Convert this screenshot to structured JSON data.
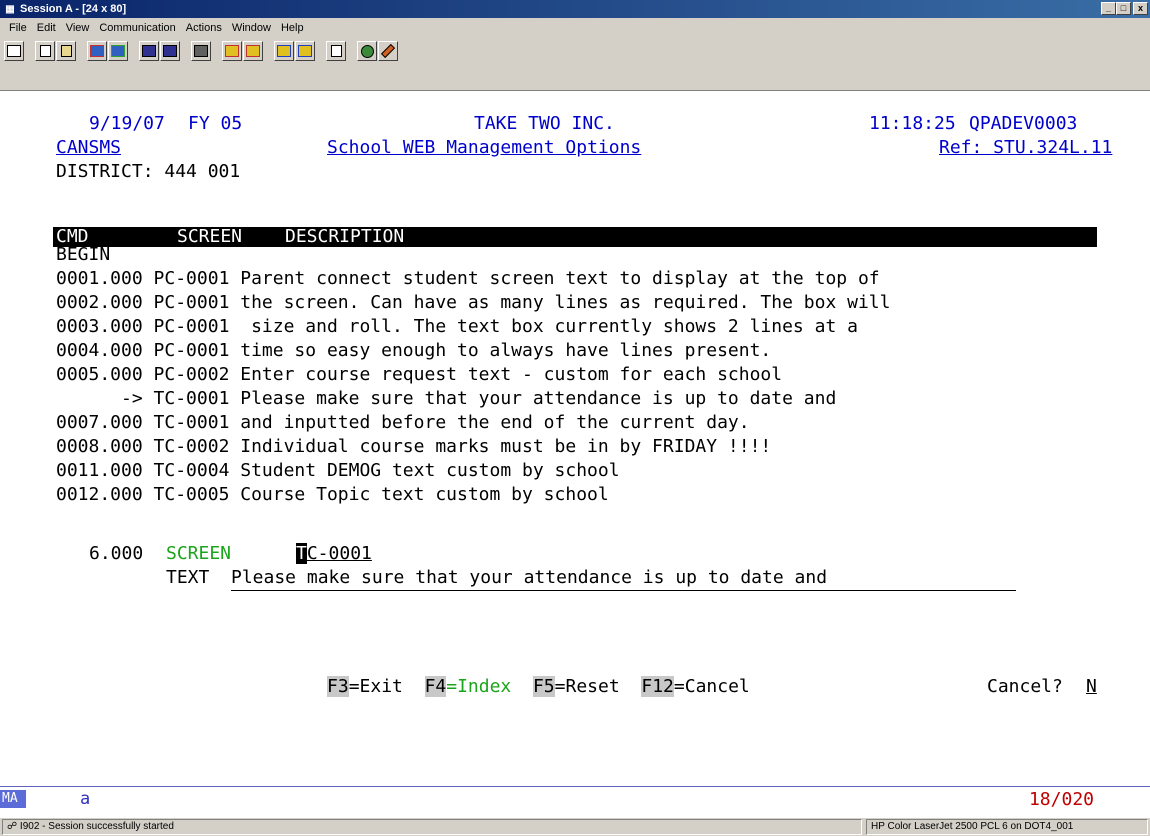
{
  "window": {
    "title": "Session A - [24 x 80]",
    "minimize": "_",
    "maximize": "□",
    "close": "x"
  },
  "menu": [
    "File",
    "Edit",
    "View",
    "Communication",
    "Actions",
    "Window",
    "Help"
  ],
  "terminal": {
    "date": "9/19/07",
    "fy": "FY 05",
    "company": "TAKE TWO INC.",
    "time": "11:18:25",
    "system": "QPADEV0003",
    "program": "CANSMS",
    "screen_title": "School WEB Management Options",
    "ref": "Ref: STU.324L.11",
    "district": "DISTRICT: 444 001",
    "columns": {
      "cmd": "CMD",
      "screen": "SCREEN",
      "description": "DESCRIPTION"
    },
    "begin": "BEGIN",
    "rows": [
      {
        "cmd": "0001.000",
        "screen": "PC-0001",
        "desc": "Parent connect student screen text to display at the top of"
      },
      {
        "cmd": "0002.000",
        "screen": "PC-0001",
        "desc": "the screen. Can have as many lines as required. The box will"
      },
      {
        "cmd": "0003.000",
        "screen": "PC-0001",
        "desc": " size and roll. The text box currently shows 2 lines at a"
      },
      {
        "cmd": "0004.000",
        "screen": "PC-0001",
        "desc": "time so easy enough to always have lines present."
      },
      {
        "cmd": "0005.000",
        "screen": "PC-0002",
        "desc": "Enter course request text - custom for each school"
      },
      {
        "cmd": "      ->",
        "screen": "TC-0001",
        "desc": "Please make sure that your attendance is up to date and"
      },
      {
        "cmd": "0007.000",
        "screen": "TC-0001",
        "desc": "and inputted before the end of the current day."
      },
      {
        "cmd": "0008.000",
        "screen": "TC-0002",
        "desc": "Individual course marks must be in by FRIDAY !!!!"
      },
      {
        "cmd": "0011.000",
        "screen": "TC-0004",
        "desc": "Student DEMOG text custom by school"
      },
      {
        "cmd": "0012.000",
        "screen": "TC-0005",
        "desc": "Course Topic text custom by school"
      }
    ],
    "edit": {
      "seq": "6.000",
      "screen_label": "SCREEN",
      "screen_value_first": "T",
      "screen_value_rest": "C-0001",
      "text_label": "TEXT",
      "text_value": "Please make sure that your attendance is up to date and"
    },
    "fkeys": [
      {
        "key": "F3",
        "label": "=Exit"
      },
      {
        "key": "F4",
        "label": "=Index"
      },
      {
        "key": "F5",
        "label": "=Reset"
      },
      {
        "key": "F12",
        "label": "=Cancel"
      }
    ],
    "cancel_prompt": "Cancel?",
    "cancel_value": "N"
  },
  "oia": {
    "mode": "MA",
    "indicator": "a",
    "cursor_pos": "18/020"
  },
  "status": {
    "message": "I902 - Session successfully started",
    "printer": "HP Color LaserJet 2500 PCL 6 on DOT4_001"
  },
  "colors": {
    "title_bar": "#0a246a",
    "terminal_blue": "#0000cc",
    "terminal_green": "#1aa51a",
    "oia_red": "#c00000"
  }
}
